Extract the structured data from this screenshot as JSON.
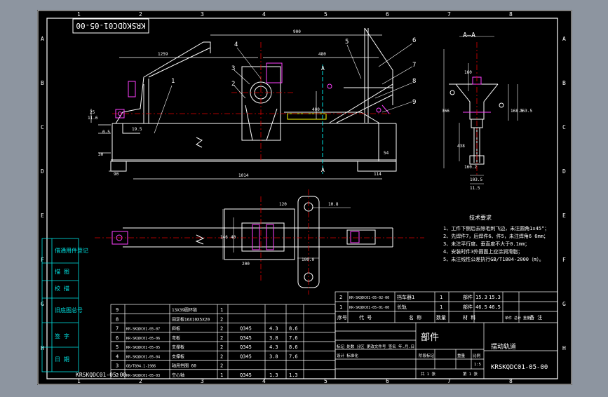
{
  "colors": {
    "bg": "#8d95a0",
    "paper": "#000000",
    "frame": "#ffffff",
    "line": "#00e5e5",
    "dim": "#ffffff",
    "part": "#ffffff",
    "center": "#e00000",
    "accent": "#ff40ff",
    "yellow": "#ffff00",
    "green": "#22ee22"
  },
  "drawing_number": "KRSKQDC01-05-00",
  "drawing_number_corner": "KRSKQDC01-05-00",
  "drawing_title": "摆动轨道",
  "title_label": "部件",
  "border_rows": [
    "A",
    "B",
    "C",
    "D",
    "E",
    "F",
    "G",
    "H"
  ],
  "border_cols": [
    "1",
    "2",
    "3",
    "4",
    "5",
    "6",
    "7",
    "8"
  ],
  "section_label": "A—A",
  "section_marks": [
    "A",
    "A"
  ],
  "balloons": [
    "1",
    "2",
    "3",
    "4",
    "5",
    "6",
    "7",
    "8",
    "9"
  ],
  "dimensions": {
    "d900": "900",
    "d1259": "1259",
    "d480": "480",
    "d400": "400",
    "d1014": "1014",
    "d90": "90",
    "d114": "114",
    "d54": "54",
    "d30": "30",
    "d195": "19.5",
    "d05": "0.5",
    "d116": "11.6",
    "d25": "25",
    "d366": "366",
    "d438": "438",
    "d160": "160",
    "d100": "100.0",
    "d108": "10.8",
    "d146": "146",
    "d40": "40",
    "d1685": "168.5",
    "d1635": "163.5",
    "d1602": "160.2",
    "d1035": "103.5",
    "d115": "11.5",
    "d200": "200",
    "d120": "120"
  },
  "left_stamps": [
    "借通用件登记",
    "描 图",
    "校 描",
    "旧底图总号",
    "签 字",
    "日 期"
  ],
  "tech_title": "技术要求",
  "tech_notes": [
    "1、工件下侧后去除毛刺飞边，未注圆角1x45°；",
    "2、先焊件7，后焊件6、件5，未注焊角6 6mm；",
    "3、未注平行度、垂直度不大于0.1mm；",
    "4、安装时件3外圆面上应涂润滑脂；",
    "5、未注线性公差执行GB/T1804-2000（m）。"
  ],
  "upper_bom": [
    {
      "no": "2",
      "code": "KR-SKQDC01-05-02-00",
      "name": "挡车器1",
      "qty": "1",
      "mat": "部件",
      "w1": "15.3",
      "w2": "15.3",
      "note": ""
    },
    {
      "no": "1",
      "code": "KR-SKQDC01-05-01-00",
      "name": "长轨",
      "qty": "1",
      "mat": "部件",
      "w1": "46.5",
      "w2": "46.5",
      "note": ""
    }
  ],
  "bom_header": [
    "序号",
    "代 号",
    "名 称",
    "数量",
    "材 料",
    "单件 总计 重量",
    "备 注"
  ],
  "lower_bom": [
    {
      "no": "9",
      "code": "",
      "name": "13X39圆环链",
      "qty": "1",
      "mat": "",
      "w1": "",
      "w2": ""
    },
    {
      "no": "8",
      "code": "",
      "name": "固定板16X10X5X20",
      "qty": "2",
      "mat": "",
      "w1": "",
      "w2": ""
    },
    {
      "no": "7",
      "code": "KR-SKQDC01-05-07",
      "name": "斜板",
      "qty": "2",
      "mat": "Q345",
      "w1": "4.3",
      "w2": "8.6"
    },
    {
      "no": "6",
      "code": "KR-SKQDC01-05-06",
      "name": "弯板",
      "qty": "2",
      "mat": "Q345",
      "w1": "3.8",
      "w2": "7.6"
    },
    {
      "no": "5",
      "code": "KR-SKQDC01-05-05",
      "name": "支撑板",
      "qty": "2",
      "mat": "Q345",
      "w1": "4.3",
      "w2": "8.6"
    },
    {
      "no": "4",
      "code": "KR-SKQDC01-05-04",
      "name": "支撑板",
      "qty": "2",
      "mat": "Q345",
      "w1": "3.8",
      "w2": "7.6"
    },
    {
      "no": "3",
      "code": "GB/T894.1-1986",
      "name": "轴用挡圈 60",
      "qty": "2",
      "mat": "",
      "w1": "",
      "w2": ""
    },
    {
      "no": "2",
      "code": "KR-SKQDC01-05-03",
      "name": "空心轴",
      "qty": "1",
      "mat": "Q345",
      "w1": "1.3",
      "w2": "1.3"
    }
  ],
  "title_block": {
    "row1": "标记 处数 分区 更改文件号 签名 年.月.日",
    "row2": "设计 标准化",
    "stage": "阶段标记",
    "weight": "重量",
    "ratio": "比例",
    "scale": "1:5",
    "sheets": "共 1 张",
    "sheet": "第 1 张"
  }
}
